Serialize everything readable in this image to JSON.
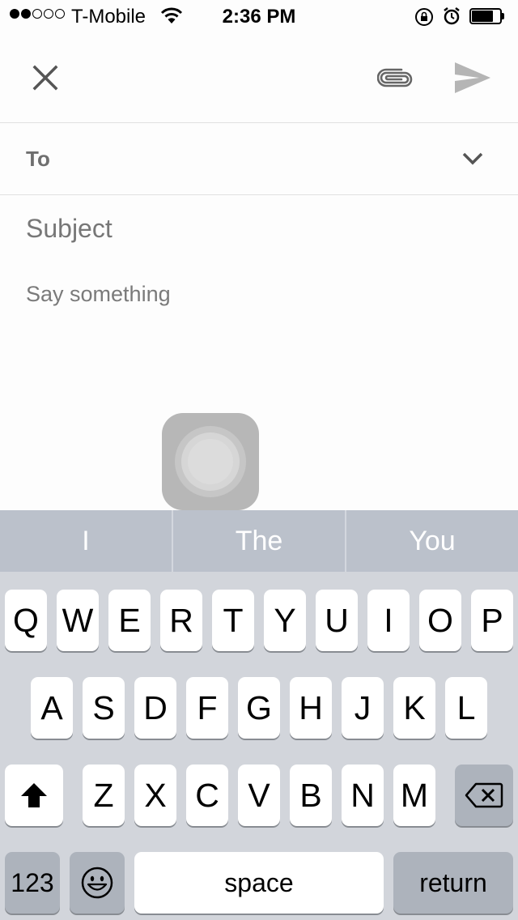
{
  "status_bar": {
    "signal_dots_filled": 2,
    "signal_dots_total": 5,
    "carrier": "T-Mobile",
    "time": "2:36 PM",
    "battery_level": 0.8
  },
  "toolbar": {
    "close_icon": "close-icon",
    "attach_icon": "paperclip-icon",
    "send_icon": "send-icon"
  },
  "compose": {
    "to_label": "To",
    "subject_placeholder": "Subject",
    "body_placeholder": "Say something"
  },
  "suggestions": [
    "I",
    "The",
    "You"
  ],
  "keyboard": {
    "row1": [
      "Q",
      "W",
      "E",
      "R",
      "T",
      "Y",
      "U",
      "I",
      "O",
      "P"
    ],
    "row2": [
      "A",
      "S",
      "D",
      "F",
      "G",
      "H",
      "J",
      "K",
      "L"
    ],
    "row3": [
      "Z",
      "X",
      "C",
      "V",
      "B",
      "N",
      "M"
    ],
    "numbers_label": "123",
    "space_label": "space",
    "return_label": "return"
  },
  "colors": {
    "keyboard_bg": "#d2d5db",
    "suggestion_bg": "#bbc1cb",
    "placeholder_gray": "#777777"
  }
}
